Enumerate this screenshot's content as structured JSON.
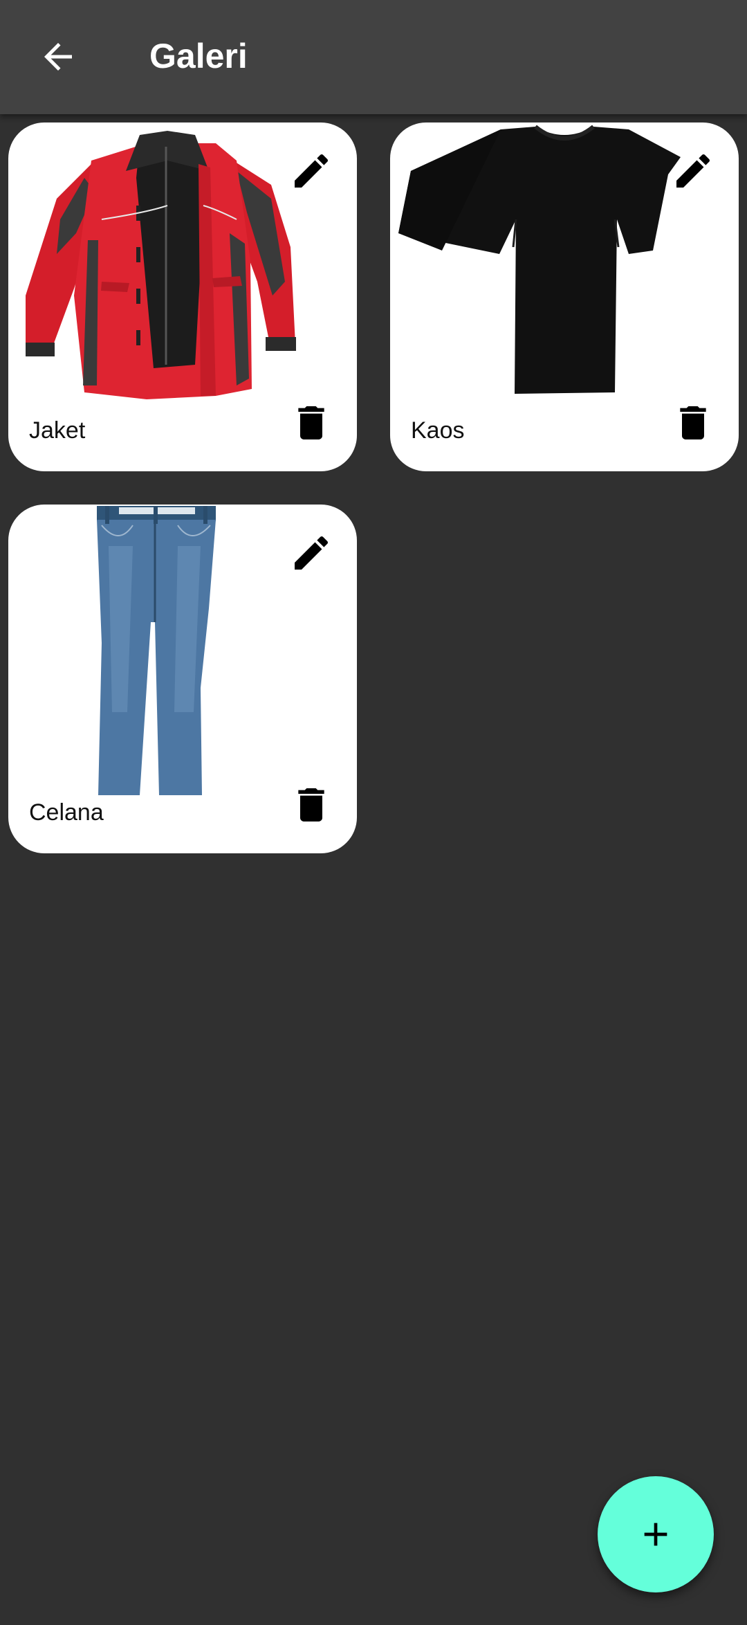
{
  "appbar": {
    "title": "Galeri",
    "back_icon": "arrow-back-icon"
  },
  "gallery": {
    "items": [
      {
        "label": "Jaket",
        "image": "red-jacket-image",
        "edit_icon": "pencil-icon",
        "delete_icon": "trash-icon"
      },
      {
        "label": "Kaos",
        "image": "black-tshirt-image",
        "edit_icon": "pencil-icon",
        "delete_icon": "trash-icon"
      },
      {
        "label": "Celana",
        "image": "blue-jeans-image",
        "edit_icon": "pencil-icon",
        "delete_icon": "trash-icon"
      }
    ]
  },
  "fab": {
    "icon": "plus-icon",
    "color": "#64ffda"
  },
  "colors": {
    "background": "#303030",
    "appbar": "#424242",
    "card": "#ffffff"
  }
}
